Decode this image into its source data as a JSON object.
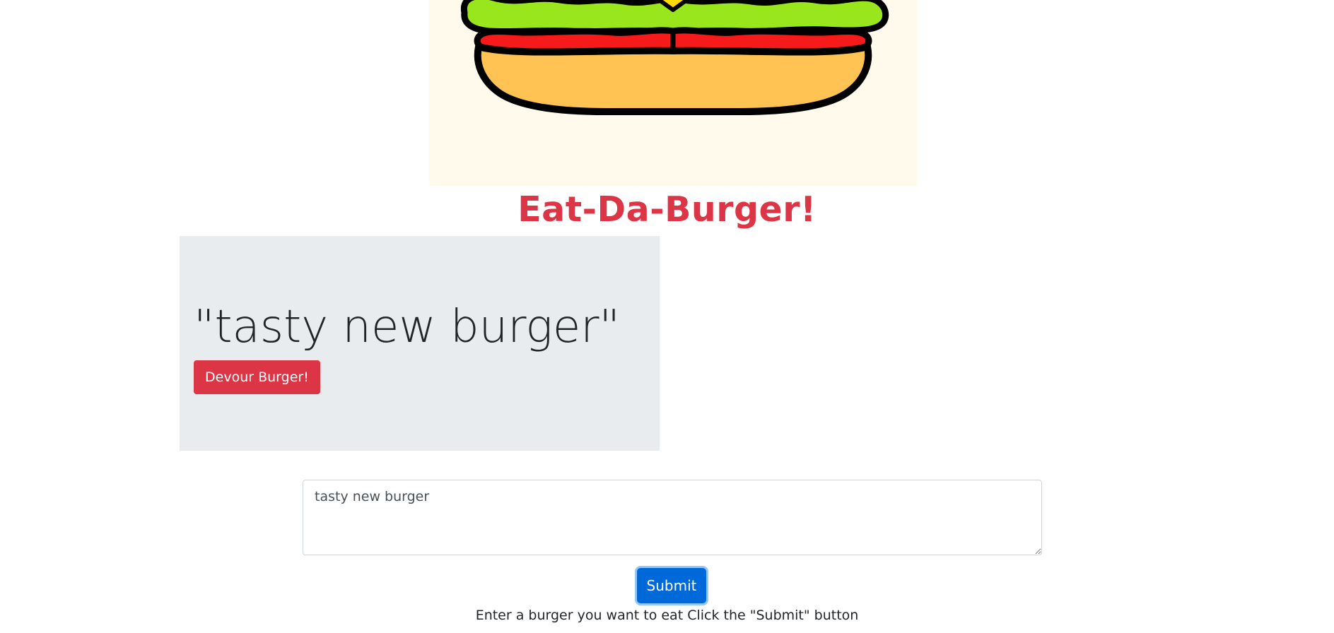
{
  "header": {
    "logo_icon": "hamburger-illustration",
    "title": "Eat-Da-Burger!"
  },
  "burgers": {
    "items": [
      {
        "name": "\"tasty new burger\"",
        "devour_label": "Devour Burger!"
      }
    ]
  },
  "form": {
    "input_value": "tasty new burger",
    "submit_label": "Submit",
    "instructions": "Enter a burger you want to eat Click the \"Submit\" button"
  },
  "colors": {
    "title": "#dc3545",
    "devour_button": "#dc3545",
    "submit_button": "#0069d9",
    "jumbotron_bg": "#e9ecef",
    "hero_bg": "#fffaec"
  }
}
